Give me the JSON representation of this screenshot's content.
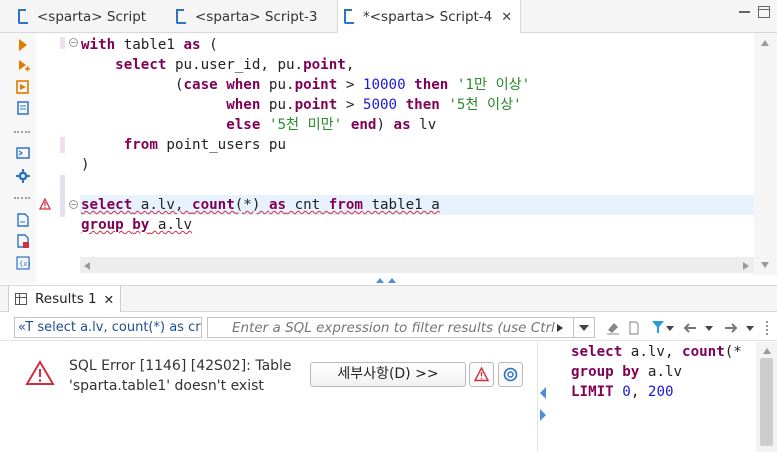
{
  "tabs": [
    {
      "label": "<sparta> Script"
    },
    {
      "label": "<sparta> Script-3"
    },
    {
      "label": "*<sparta> Script-4",
      "close": "✕"
    }
  ],
  "editor": {
    "lines": [
      {
        "parts": [
          [
            "kw",
            "with"
          ],
          [
            "txt",
            " table1 "
          ],
          [
            "kw",
            "as"
          ],
          [
            "txt",
            " ("
          ]
        ]
      },
      {
        "parts": [
          [
            "txt",
            "    "
          ],
          [
            "kw",
            "select"
          ],
          [
            "txt",
            " pu.user_id, pu."
          ],
          [
            "kw",
            "point"
          ],
          [
            "txt",
            ","
          ]
        ]
      },
      {
        "parts": [
          [
            "txt",
            "           ("
          ],
          [
            "kw",
            "case"
          ],
          [
            "txt",
            " "
          ],
          [
            "kw",
            "when"
          ],
          [
            "txt",
            " pu."
          ],
          [
            "kw",
            "point"
          ],
          [
            "txt",
            " > "
          ],
          [
            "num",
            "10000"
          ],
          [
            "txt",
            " "
          ],
          [
            "kw",
            "then"
          ],
          [
            "txt",
            " "
          ],
          [
            "str",
            "'1만 이상'"
          ]
        ]
      },
      {
        "parts": [
          [
            "txt",
            "                 "
          ],
          [
            "kw",
            "when"
          ],
          [
            "txt",
            " pu."
          ],
          [
            "kw",
            "point"
          ],
          [
            "txt",
            " > "
          ],
          [
            "num",
            "5000"
          ],
          [
            "txt",
            " "
          ],
          [
            "kw",
            "then"
          ],
          [
            "txt",
            " "
          ],
          [
            "str",
            "'5천 이상'"
          ]
        ]
      },
      {
        "parts": [
          [
            "txt",
            "                 "
          ],
          [
            "kw",
            "else"
          ],
          [
            "txt",
            " "
          ],
          [
            "str",
            "'5천 미만'"
          ],
          [
            "txt",
            " "
          ],
          [
            "kw",
            "end"
          ],
          [
            "txt",
            ") "
          ],
          [
            "kw",
            "as"
          ],
          [
            "txt",
            " lv"
          ]
        ]
      },
      {
        "parts": [
          [
            "txt",
            "     "
          ],
          [
            "kw",
            "from"
          ],
          [
            "txt",
            " point_users pu"
          ]
        ]
      },
      {
        "parts": [
          [
            "txt",
            ")"
          ]
        ]
      },
      {
        "parts": [
          [
            "txt",
            ""
          ]
        ]
      },
      {
        "parts": [
          [
            "kwu",
            "select"
          ],
          [
            "txtu",
            " a.lv, "
          ],
          [
            "kwu",
            "count"
          ],
          [
            "txtu",
            "(*) "
          ],
          [
            "kwu",
            "as"
          ],
          [
            "txtu",
            " cnt "
          ],
          [
            "kwu",
            "from"
          ],
          [
            "txtu",
            " table1 a"
          ]
        ]
      },
      {
        "parts": [
          [
            "kwu",
            "group"
          ],
          [
            "txtu",
            " "
          ],
          [
            "kwu",
            "by"
          ],
          [
            "txtu",
            " a.lv"
          ]
        ]
      }
    ]
  },
  "results": {
    "tab_label": "Results 1",
    "tab_close": "✕",
    "query_preview": "«T select a.lv, count(*) as cr",
    "filter_placeholder": "Enter a SQL expression to filter results (use Ctrl",
    "error_line1": "SQL Error [1146] [42S02]: Table",
    "error_line2": "'sparta.table1' doesn't exist",
    "details_button": "세부사항(D) >>",
    "sql_preview": [
      {
        "parts": [
          [
            "kw",
            "select"
          ],
          [
            "txt",
            " a.lv, "
          ],
          [
            "kw",
            "count"
          ],
          [
            "txt",
            "(*"
          ]
        ]
      },
      {
        "parts": [
          [
            "kw",
            "group"
          ],
          [
            "txt",
            " "
          ],
          [
            "kw",
            "by"
          ],
          [
            "txt",
            " a.lv"
          ]
        ]
      },
      {
        "parts": [
          [
            "kw",
            "LIMIT"
          ],
          [
            "txt",
            " "
          ],
          [
            "num",
            "0"
          ],
          [
            "txt",
            ", "
          ],
          [
            "num",
            "200"
          ]
        ]
      }
    ]
  },
  "colors": {
    "keyword": "#7f0055",
    "number": "#1a1adb",
    "string": "#2a8a2a",
    "error": "#d03040",
    "accent": "#2d74c9"
  }
}
